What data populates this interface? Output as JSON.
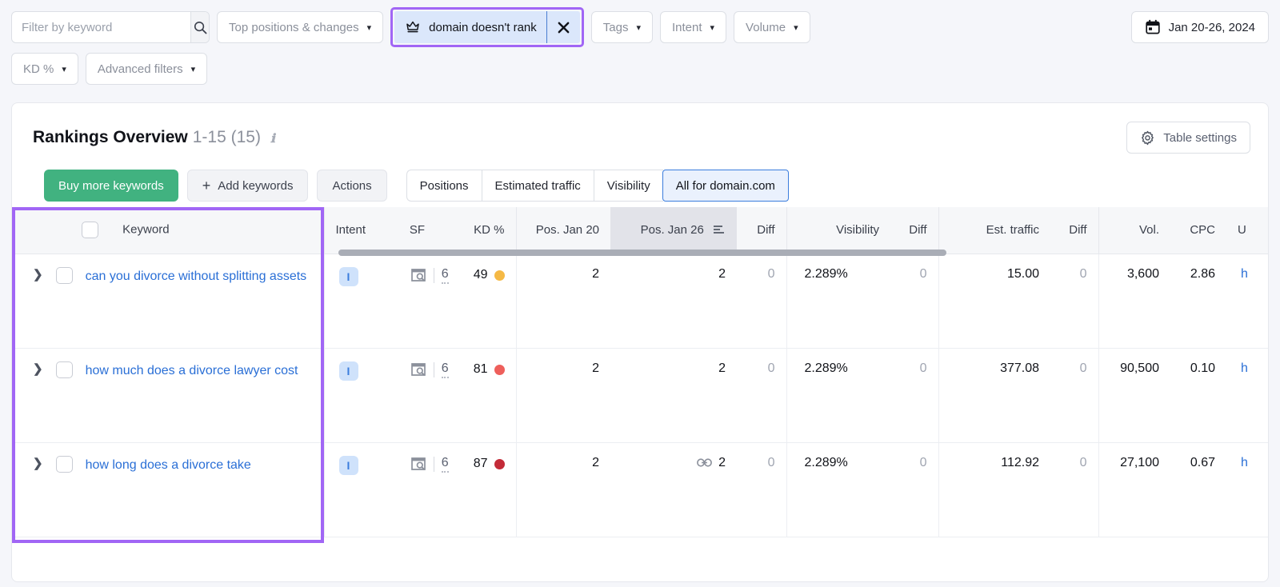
{
  "filters": {
    "keyword_search": {
      "placeholder": "Filter by keyword",
      "value": "",
      "icon": "search-icon"
    },
    "positions_dropdown": "Top positions & changes",
    "active_chip": {
      "label": "domain doesn't rank",
      "icon": "crown-icon",
      "close_icon": "close-x-icon"
    },
    "tags_dropdown": "Tags",
    "intent_dropdown": "Intent",
    "volume_dropdown": "Volume",
    "kd_dropdown": "KD %",
    "advanced_dropdown": "Advanced filters",
    "date_range": {
      "label": "Jan 20-26, 2024",
      "icon": "calendar-icon"
    }
  },
  "card": {
    "title": "Rankings Overview",
    "range": "1-15 (15)",
    "info_icon": "info-icon",
    "table_settings": {
      "label": "Table settings",
      "icon": "gear-icon"
    }
  },
  "actions": {
    "buy_more": "Buy more keywords",
    "add_keywords": "Add keywords",
    "actions": "Actions",
    "tabs": [
      {
        "label": "Positions",
        "active": false
      },
      {
        "label": "Estimated traffic",
        "active": false
      },
      {
        "label": "Visibility",
        "active": false
      },
      {
        "label": "All for domain.com",
        "active": true
      }
    ]
  },
  "table": {
    "columns": [
      "Keyword",
      "Intent",
      "SF",
      "KD %",
      "Pos. Jan 20",
      "Pos. Jan 26",
      "Diff",
      "Visibility",
      "Diff",
      "Est. traffic",
      "Diff",
      "Vol.",
      "CPC",
      "U"
    ],
    "sorted_column": "Pos. Jan 26",
    "rows": [
      {
        "keyword": "can you divorce without splitting assets",
        "intent": "I",
        "sf_icon": "serp-feature-icon",
        "sf": "6",
        "kd": "49",
        "kd_color": "#f5b945",
        "pos_jan20": "2",
        "pos_jan26": "2",
        "pos_jan26_icon": "",
        "pos_diff": "0",
        "visibility": "2.289%",
        "visibility_diff": "0",
        "est_traffic": "15.00",
        "traffic_diff": "0",
        "volume": "3,600",
        "cpc": "2.86",
        "url": "h"
      },
      {
        "keyword": "how much does a divorce lawyer cost",
        "intent": "I",
        "sf_icon": "serp-feature-icon",
        "sf": "6",
        "kd": "81",
        "kd_color": "#ee5f5b",
        "pos_jan20": "2",
        "pos_jan26": "2",
        "pos_jan26_icon": "",
        "pos_diff": "0",
        "visibility": "2.289%",
        "visibility_diff": "0",
        "est_traffic": "377.08",
        "traffic_diff": "0",
        "volume": "90,500",
        "cpc": "0.10",
        "url": "h"
      },
      {
        "keyword": "how long does a divorce take",
        "intent": "I",
        "sf_icon": "serp-feature-icon",
        "sf": "6",
        "kd": "87",
        "kd_color": "#c32b38",
        "pos_jan20": "2",
        "pos_jan26": "2",
        "pos_jan26_icon": "link-icon",
        "pos_diff": "0",
        "visibility": "2.289%",
        "visibility_diff": "0",
        "est_traffic": "112.92",
        "traffic_diff": "0",
        "volume": "27,100",
        "cpc": "0.67",
        "url": "h"
      }
    ]
  },
  "annotations": {
    "chip_highlight_color": "#a166f5",
    "keyword_column_highlight_color": "#a166f5"
  }
}
